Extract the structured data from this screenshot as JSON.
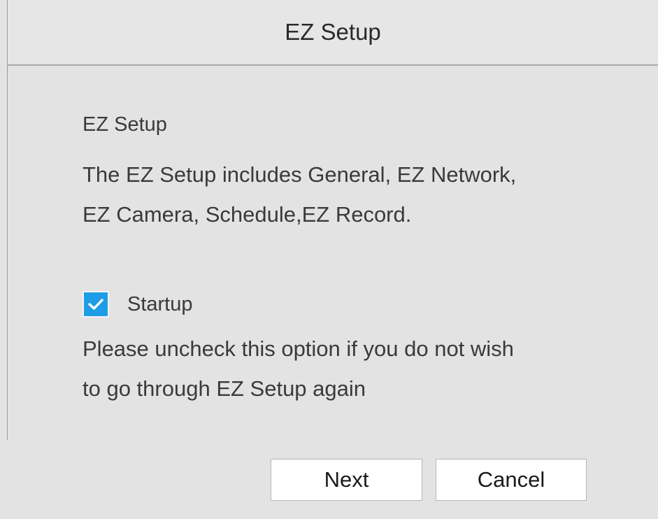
{
  "window": {
    "title": "EZ Setup"
  },
  "content": {
    "heading": "EZ Setup",
    "description_lines": [
      "The EZ Setup includes General, EZ Network,",
      "EZ Camera, Schedule,EZ Record."
    ],
    "startup_checkbox": {
      "label": "Startup",
      "checked": true,
      "color": "#1e9de6"
    },
    "note_lines": [
      "Please uncheck this option if you do not wish",
      "to go through EZ Setup again"
    ]
  },
  "buttons": {
    "next_label": "Next",
    "cancel_label": "Cancel"
  },
  "icons": {
    "checkbox_mark": "checkmark-icon"
  }
}
